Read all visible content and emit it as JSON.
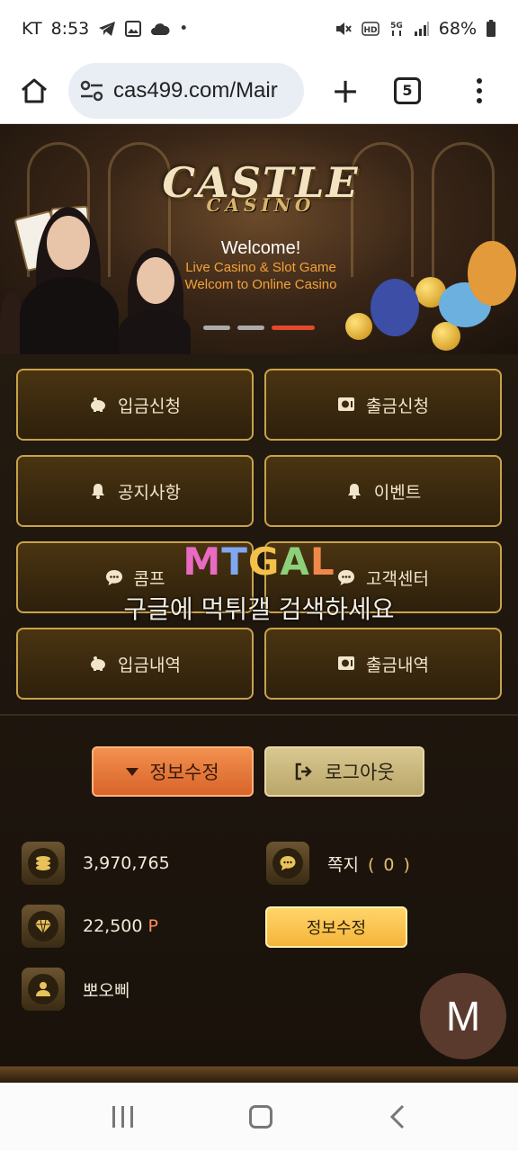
{
  "status_bar": {
    "carrier": "KT",
    "time": "8:53",
    "left_icons": [
      "telegram-icon",
      "gallery-icon",
      "cloud-icon",
      "dot-icon"
    ],
    "right_icons": [
      "mute-icon",
      "hd-icon",
      "5g-icon",
      "signal-icon"
    ],
    "battery": "68%"
  },
  "browser": {
    "url": "cas499.com/Mair",
    "tab_count": "5"
  },
  "banner": {
    "logo_main": "CASTLE",
    "logo_sub": "CASINO",
    "welcome_title": "Welcome!",
    "welcome_line1": "Live Casino & Slot Game",
    "welcome_line2": "Welcom to Online Casino",
    "slide_count": 3,
    "active_slide": 3
  },
  "menu": [
    {
      "label": "입금신청",
      "icon": "piggy-bank-icon"
    },
    {
      "label": "출금신청",
      "icon": "safe-icon"
    },
    {
      "label": "공지사항",
      "icon": "bell-icon"
    },
    {
      "label": "이벤트",
      "icon": "bell-icon"
    },
    {
      "label": "콤프",
      "icon": "chat-icon"
    },
    {
      "label": "고객센터",
      "icon": "chat-icon"
    },
    {
      "label": "입금내역",
      "icon": "piggy-bank-icon"
    },
    {
      "label": "출금내역",
      "icon": "safe-icon"
    }
  ],
  "watermark": {
    "logo": "MTGAL",
    "text": "구글에 먹튀갤 검색하세요"
  },
  "actions": {
    "edit_label": "정보수정",
    "logout_label": "로그아웃"
  },
  "account": {
    "balance": "3,970,765",
    "points": "22,500",
    "points_unit": "P",
    "username": "뽀오삐",
    "messages_label": "쪽지",
    "messages_count": "( 0 )",
    "edit_button": "정보수정"
  },
  "fab": {
    "label": "M"
  },
  "colors": {
    "gold_border": "#c9a24a",
    "orange_button": "#f2904f",
    "yellow_button": "#ffd56a",
    "active_dot": "#e24a2c"
  }
}
